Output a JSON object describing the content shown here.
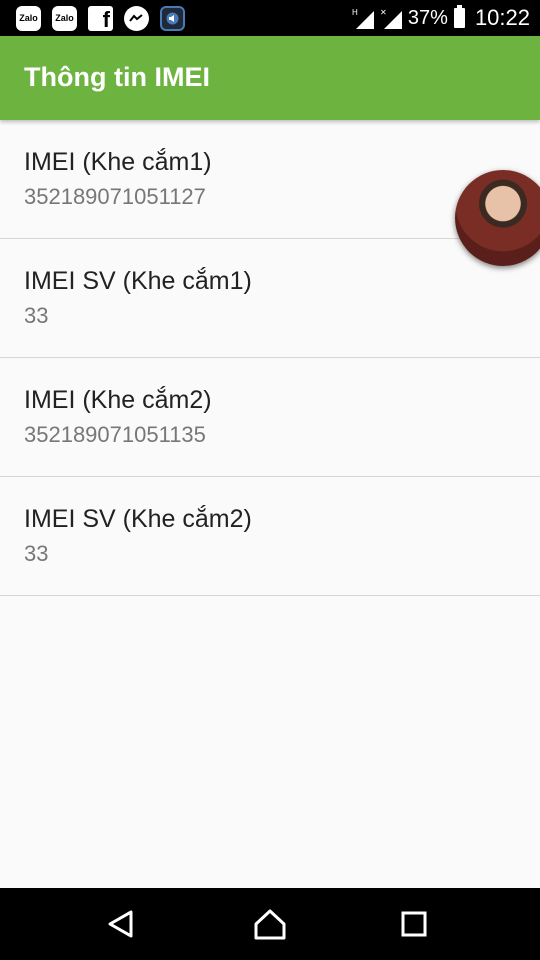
{
  "statusbar": {
    "notification_icons": [
      "zalo-icon",
      "zalo-icon",
      "facebook-icon",
      "messenger-icon",
      "volume-icon"
    ],
    "battery_percent": "37%",
    "time": "10:22"
  },
  "appbar": {
    "title": "Thông tin IMEI"
  },
  "items": [
    {
      "title": "IMEI (Khe cắm1)",
      "value": "352189071051127"
    },
    {
      "title": "IMEI SV (Khe cắm1)",
      "value": "33"
    },
    {
      "title": "IMEI (Khe cắm2)",
      "value": "352189071051135"
    },
    {
      "title": "IMEI SV (Khe cắm2)",
      "value": "33"
    }
  ],
  "colors": {
    "appbar": "#6db33f",
    "background": "#fafafa"
  },
  "navbar": {
    "buttons": [
      "back-icon",
      "home-icon",
      "recents-icon"
    ]
  }
}
